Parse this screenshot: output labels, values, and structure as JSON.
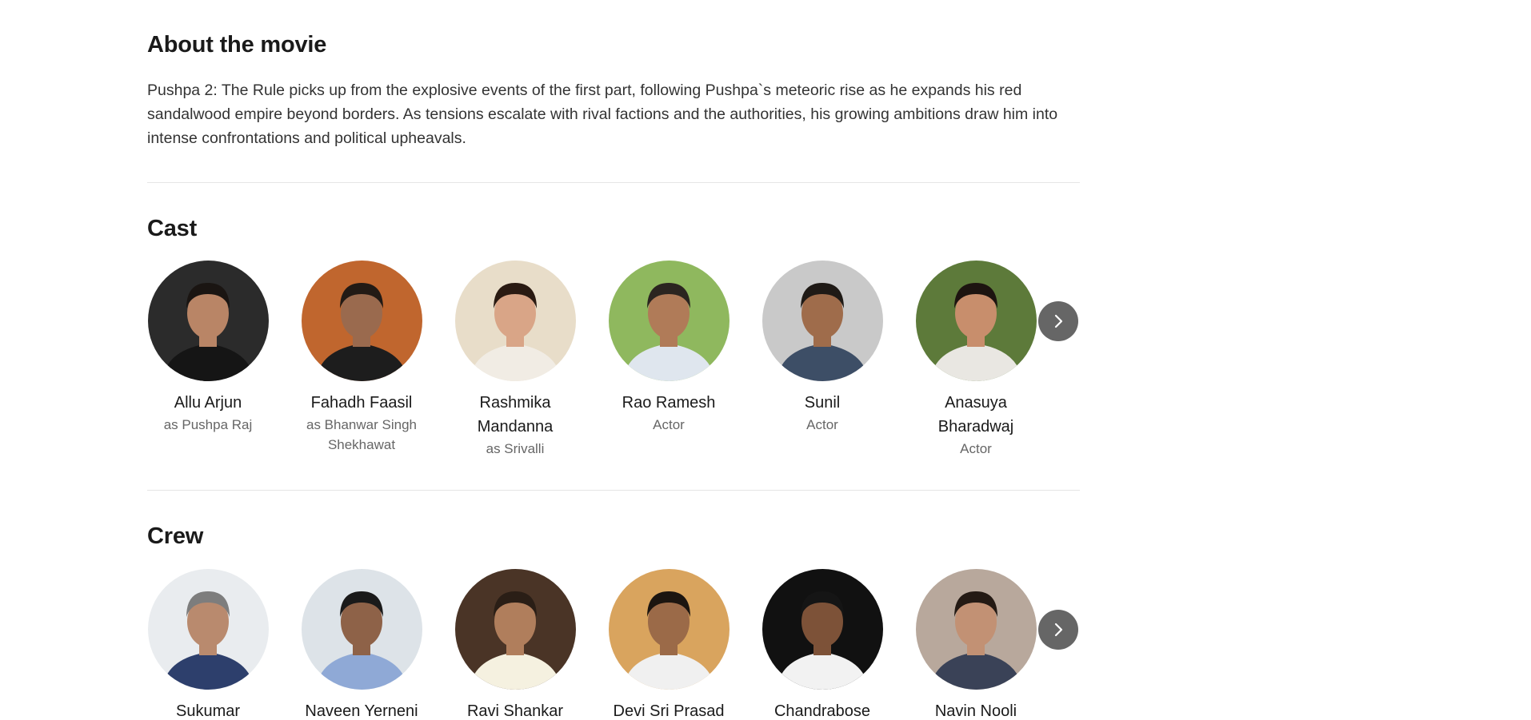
{
  "about": {
    "title": "About the movie",
    "description": "Pushpa 2: The Rule picks up from the explosive events of the first part, following Pushpa`s meteoric rise as he expands his red sandalwood empire beyond borders. As tensions escalate with rival factions and the authorities, his growing ambitions draw him into intense confrontations and political upheavals."
  },
  "cast": {
    "title": "Cast",
    "members": [
      {
        "name": "Allu Arjun",
        "role": "as Pushpa Raj",
        "bg": "#2b2b2b",
        "skin": "#b98566",
        "hair": "#1a1512",
        "shirt": "#151515"
      },
      {
        "name": "Fahadh Faasil",
        "role": "as Bhanwar Singh Shekhawat",
        "bg": "#c0662e",
        "skin": "#9a6a4e",
        "hair": "#221a15",
        "shirt": "#1d1d1d"
      },
      {
        "name": "Rashmika Mandanna",
        "role": "as Srivalli",
        "bg": "#e8ddc9",
        "skin": "#d9a587",
        "hair": "#2a1a12",
        "shirt": "#f1ece4"
      },
      {
        "name": "Rao Ramesh",
        "role": "Actor",
        "bg": "#8fb85e",
        "skin": "#b07b58",
        "hair": "#2b2520",
        "shirt": "#dfe6ee"
      },
      {
        "name": "Sunil",
        "role": "Actor",
        "bg": "#c9c9c9",
        "skin": "#9f6c4b",
        "hair": "#1f1a16",
        "shirt": "#3d4e66"
      },
      {
        "name": "Anasuya Bharadwaj",
        "role": "Actor",
        "bg": "#5d7a3a",
        "skin": "#c88e6c",
        "hair": "#1d1410",
        "shirt": "#e9e7e2"
      }
    ],
    "next_label": "Next"
  },
  "crew": {
    "title": "Crew",
    "members": [
      {
        "name": "Sukumar",
        "bg": "#e9ecef",
        "skin": "#b98a6e",
        "hair": "#7d7d7d",
        "shirt": "#2d3f6c"
      },
      {
        "name": "Naveen Yerneni",
        "bg": "#dde3e8",
        "skin": "#8e6248",
        "hair": "#1a1a1a",
        "shirt": "#8fa9d6"
      },
      {
        "name": "Ravi Shankar",
        "bg": "#4a3426",
        "skin": "#b07e5c",
        "hair": "#2a1e16",
        "shirt": "#f5f1e0"
      },
      {
        "name": "Devi Sri Prasad",
        "bg": "#d9a45e",
        "skin": "#9b6a48",
        "hair": "#1c1510",
        "shirt": "#f0f0f0"
      },
      {
        "name": "Chandrabose",
        "bg": "#111111",
        "skin": "#7d5238",
        "hair": "#151515",
        "shirt": "#f2f2f2"
      },
      {
        "name": "Navin Nooli",
        "bg": "#b8a89c",
        "skin": "#c29174",
        "hair": "#241a14",
        "shirt": "#3a4257"
      }
    ],
    "next_label": "Next"
  }
}
